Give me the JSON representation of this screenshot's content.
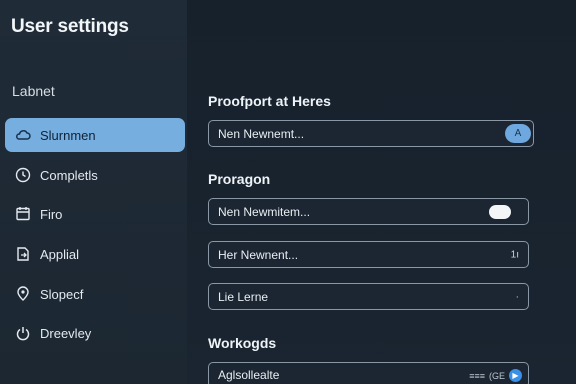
{
  "app": {
    "title": "User settings"
  },
  "sidebar": {
    "section_label": "Labnet",
    "items": [
      {
        "label": "Slurnmen",
        "icon": "cloud-icon",
        "active": true
      },
      {
        "label": "Completls",
        "icon": "clock-icon",
        "active": false
      },
      {
        "label": "Firo",
        "icon": "calendar-icon",
        "active": false
      },
      {
        "label": "Applial",
        "icon": "document-export-icon",
        "active": false
      },
      {
        "label": "Slopecf",
        "icon": "location-pin-icon",
        "active": false
      },
      {
        "label": "Dreevley",
        "icon": "power-icon",
        "active": false
      }
    ]
  },
  "main": {
    "section1": {
      "heading": "Proofport at Heres",
      "field": {
        "value": "Nen Newnemt...",
        "toggle_glyph": "A"
      }
    },
    "section2": {
      "heading": "Proragon",
      "fields": [
        {
          "value": "Nen Newmitem..."
        },
        {
          "value": "Her Newnent...",
          "trail": "1ı"
        },
        {
          "value": "Lie Lerne",
          "trail": "·"
        }
      ]
    },
    "section3": {
      "heading": "Workogds",
      "field": {
        "value": "Aglsollealte",
        "trail_text": "≡≡≡",
        "trail_code": "(GE",
        "trail_dot": "▶"
      }
    }
  },
  "colors": {
    "accent": "#77aee0",
    "sidebar_bg": "#1f2b37",
    "main_bg": "#17212c",
    "field_border": "#8a97a4"
  }
}
